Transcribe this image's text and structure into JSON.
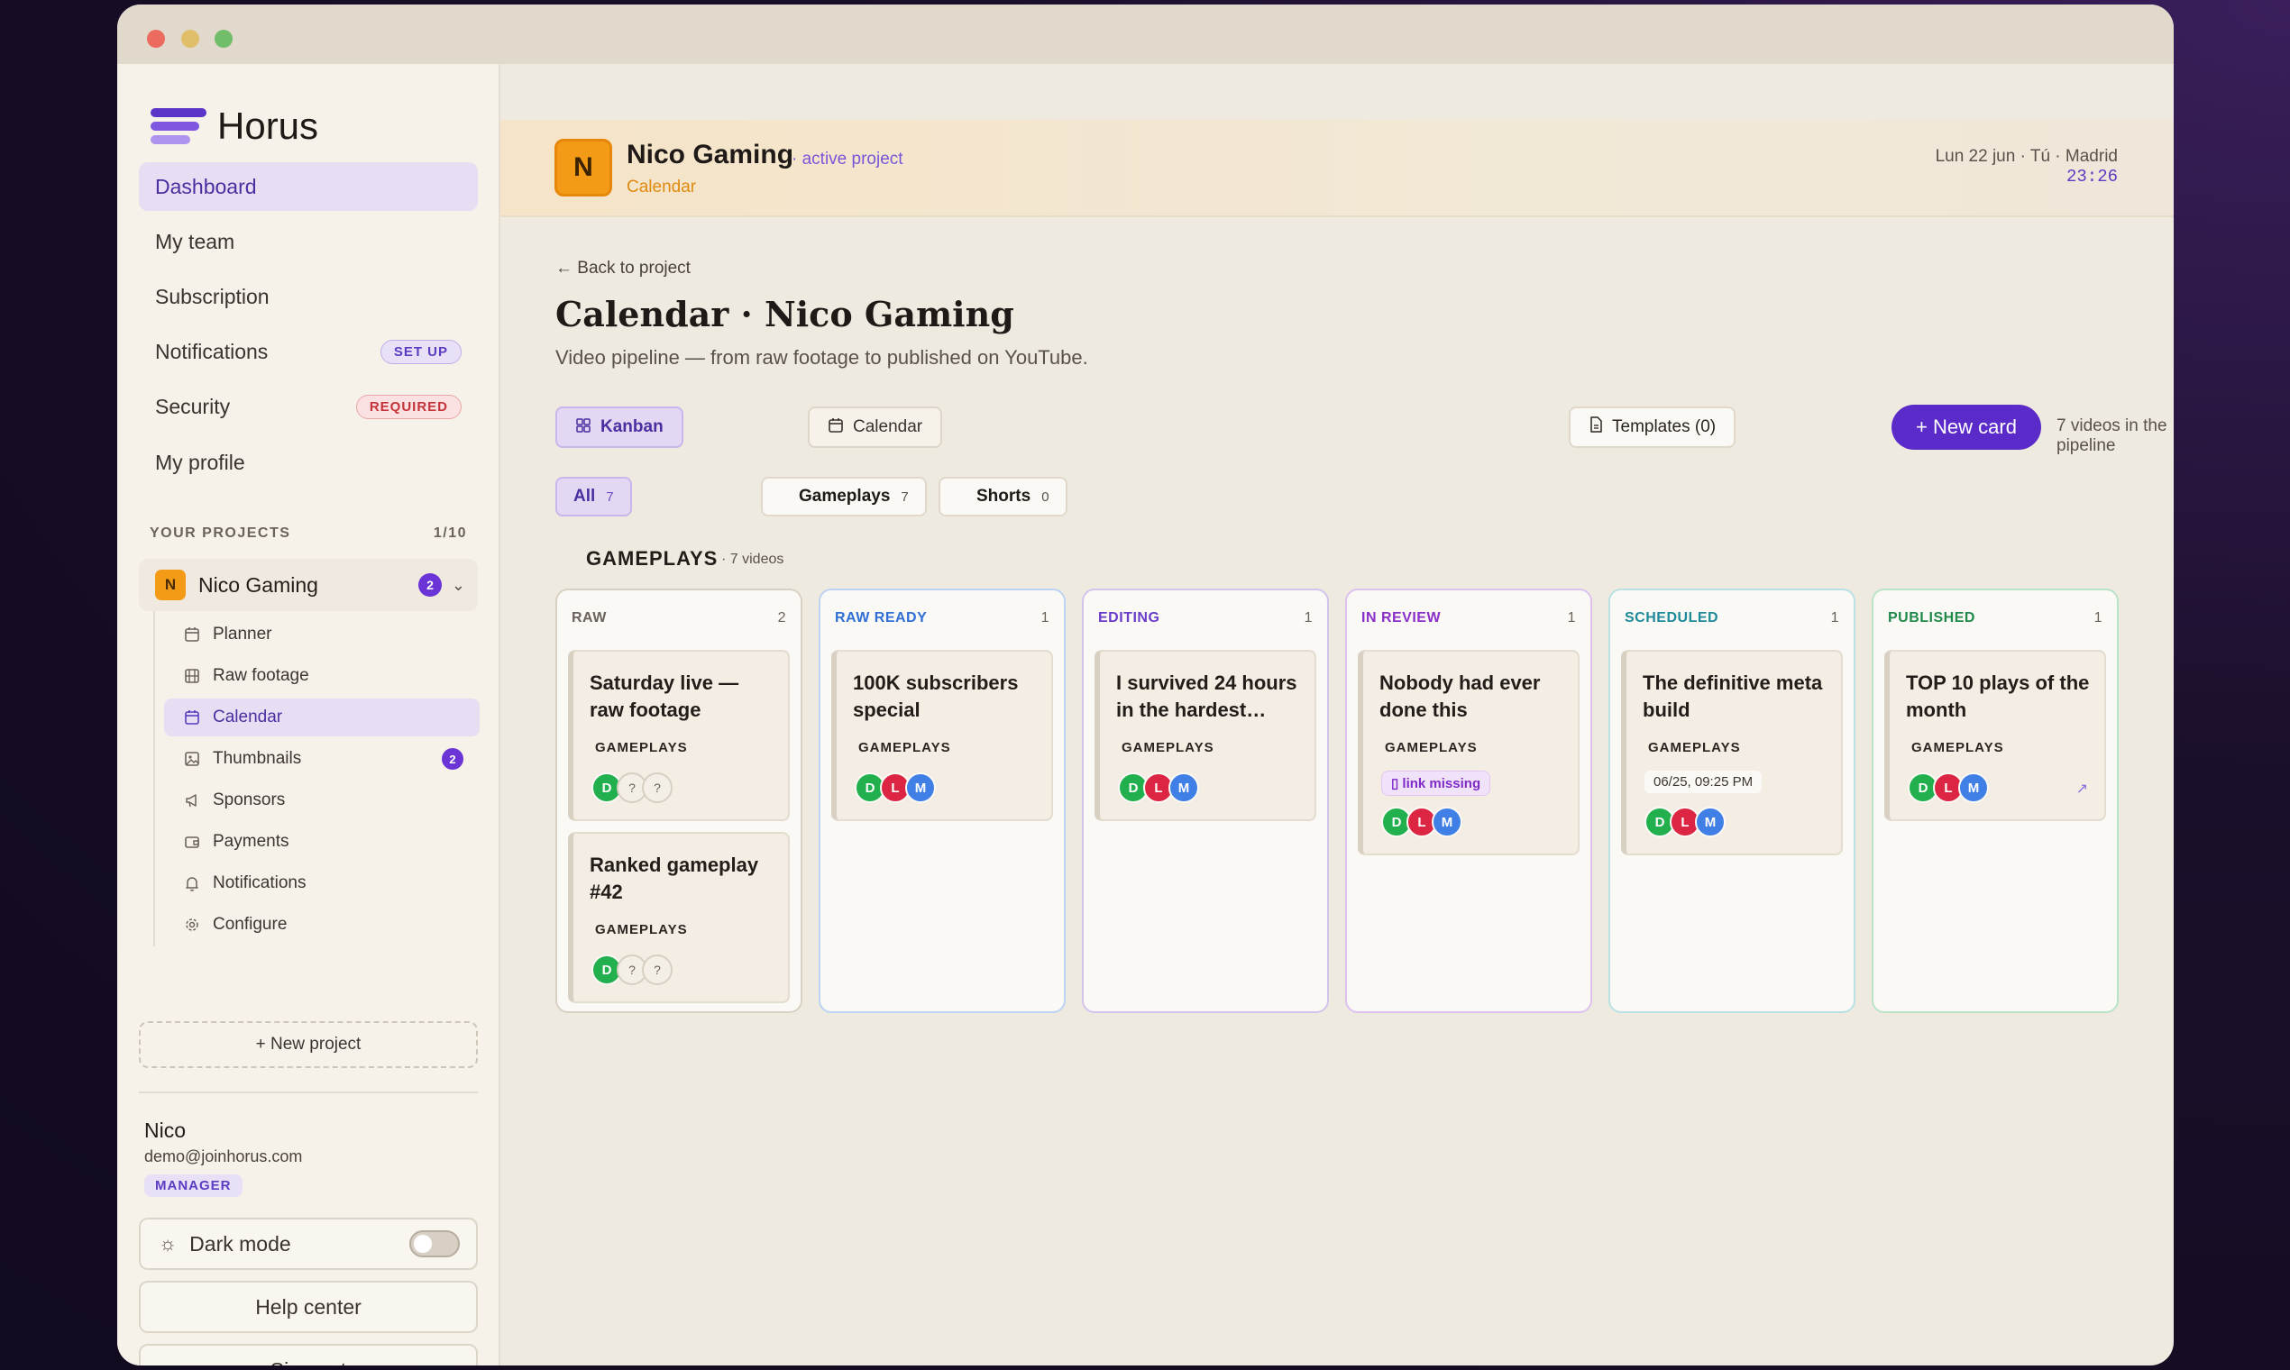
{
  "app": {
    "name": "Horus"
  },
  "sidebar": {
    "nav": [
      {
        "label": "Dashboard"
      },
      {
        "label": "My team"
      },
      {
        "label": "Subscription"
      },
      {
        "label": "Notifications",
        "badge": "SET UP"
      },
      {
        "label": "Security",
        "badge": "REQUIRED"
      },
      {
        "label": "My profile"
      }
    ],
    "projects_title": "YOUR PROJECTS",
    "projects_count": "1/10",
    "project": {
      "initial": "N",
      "name": "Nico Gaming",
      "count": "2"
    },
    "subnav": [
      {
        "label": "Planner",
        "icon": "calendar-icon"
      },
      {
        "label": "Raw footage",
        "icon": "film-icon"
      },
      {
        "label": "Calendar",
        "icon": "calendar-icon"
      },
      {
        "label": "Thumbnails",
        "icon": "image-icon",
        "count": "2"
      },
      {
        "label": "Sponsors",
        "icon": "megaphone-icon"
      },
      {
        "label": "Payments",
        "icon": "wallet-icon"
      },
      {
        "label": "Notifications",
        "icon": "bell-icon"
      },
      {
        "label": "Configure",
        "icon": "gear-icon"
      }
    ],
    "new_project": "+ New project",
    "user": {
      "name": "Nico",
      "email": "demo@joinhorus.com",
      "role": "MANAGER"
    },
    "dark_mode": "Dark mode",
    "help": "Help center",
    "signout": "Sign out"
  },
  "banner": {
    "initial": "N",
    "title": "Nico Gaming",
    "status": "· active project",
    "subtitle": "Calendar",
    "date": "Lun 22 jun · Tú · Madrid",
    "time": "23:26"
  },
  "page": {
    "back": "← Back to project",
    "title": "Calendar · Nico Gaming",
    "description": "Video pipeline — from raw footage to published on YouTube.",
    "view_kanban": "Kanban",
    "view_calendar": "Calendar",
    "templates": "Templates (0)",
    "new_card": "+ New card",
    "pipeline_count": "7 videos in the pipeline",
    "filters": [
      {
        "label": "All",
        "count": "7"
      },
      {
        "label": "Gameplays",
        "count": "7"
      },
      {
        "label": "Shorts",
        "count": "0"
      }
    ],
    "group_title": "GAMEPLAYS",
    "group_count": "· 7 videos"
  },
  "columns": [
    {
      "name": "RAW",
      "count": "2",
      "color": "#6b625b",
      "border": "#d8d0c3",
      "cards": [
        {
          "title": "Saturday live — raw footage",
          "tag": "GAMEPLAYS",
          "avatars": [
            "D",
            "?",
            "?"
          ]
        },
        {
          "title": "Ranked gameplay #42",
          "tag": "GAMEPLAYS",
          "avatars": [
            "D",
            "?",
            "?"
          ]
        }
      ]
    },
    {
      "name": "RAW READY",
      "count": "1",
      "color": "#2f6fd6",
      "border": "#bcd3f2",
      "cards": [
        {
          "title": "100K subscribers special",
          "tag": "GAMEPLAYS",
          "avatars": [
            "D",
            "L",
            "M"
          ]
        }
      ]
    },
    {
      "name": "EDITING",
      "count": "1",
      "color": "#6a3cc9",
      "border": "#d3c4ee",
      "cards": [
        {
          "title": "I survived 24 hours in the hardest…",
          "tag": "GAMEPLAYS",
          "avatars": [
            "D",
            "L",
            "M"
          ]
        }
      ]
    },
    {
      "name": "IN REVIEW",
      "count": "1",
      "color": "#8a2fc9",
      "border": "#ddc2ef",
      "cards": [
        {
          "title": "Nobody had ever done this",
          "tag": "GAMEPLAYS",
          "warning": "link missing",
          "avatars": [
            "D",
            "L",
            "M"
          ]
        }
      ]
    },
    {
      "name": "SCHEDULED",
      "count": "1",
      "color": "#1f8a9a",
      "border": "#b9e1e4",
      "cards": [
        {
          "title": "The definitive meta build",
          "tag": "GAMEPLAYS",
          "date": "06/25, 09:25 PM",
          "avatars": [
            "D",
            "L",
            "M"
          ]
        }
      ]
    },
    {
      "name": "PUBLISHED",
      "count": "1",
      "color": "#1f8a4a",
      "border": "#b9e4c8",
      "cards": [
        {
          "title": "TOP 10 plays of the month",
          "tag": "GAMEPLAYS",
          "avatars": [
            "D",
            "L",
            "M"
          ],
          "external": "↗"
        }
      ]
    }
  ]
}
